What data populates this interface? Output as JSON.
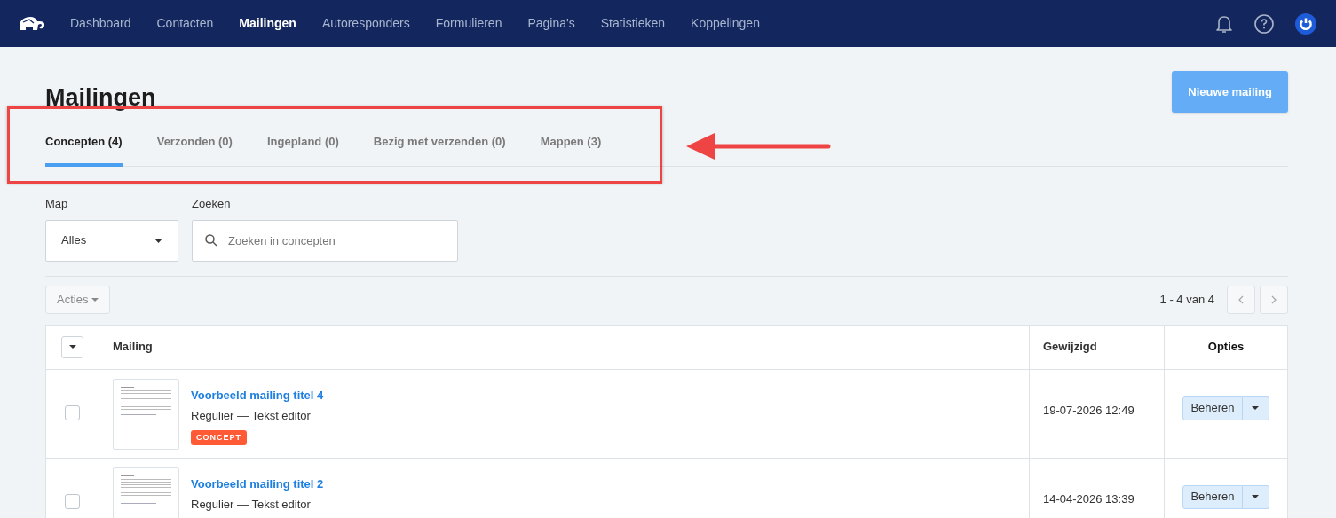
{
  "nav": {
    "items": [
      {
        "label": "Dashboard",
        "selected": false
      },
      {
        "label": "Contacten",
        "selected": false
      },
      {
        "label": "Mailingen",
        "selected": true
      },
      {
        "label": "Autoresponders",
        "selected": false
      },
      {
        "label": "Formulieren",
        "selected": false
      },
      {
        "label": "Pagina's",
        "selected": false
      },
      {
        "label": "Statistieken",
        "selected": false
      },
      {
        "label": "Koppelingen",
        "selected": false
      }
    ]
  },
  "page": {
    "title": "Mailingen",
    "new_button": "Nieuwe mailing"
  },
  "tabs": [
    {
      "label": "Concepten (4)",
      "selected": true
    },
    {
      "label": "Verzonden (0)",
      "selected": false
    },
    {
      "label": "Ingepland (0)",
      "selected": false
    },
    {
      "label": "Bezig met verzenden (0)",
      "selected": false
    },
    {
      "label": "Mappen (3)",
      "selected": false
    }
  ],
  "filters": {
    "folder_label": "Map",
    "folder_value": "Alles",
    "search_label": "Zoeken",
    "search_placeholder": "Zoeken in concepten"
  },
  "toolbar": {
    "actions": "Acties",
    "pagination": "1 - 4 van 4"
  },
  "table": {
    "columns": [
      "Mailing",
      "Gewijzigd",
      "Opties"
    ],
    "rows": [
      {
        "checked": false,
        "title": "Voorbeeld mailing titel 4",
        "subtitle": "Regulier — Tekst editor",
        "badge": "CONCEPT",
        "modified": "19-07-2026 12:49",
        "action": "Beheren"
      },
      {
        "checked": false,
        "title": "Voorbeeld mailing titel 2",
        "subtitle": "Regulier — Tekst editor",
        "modified": "14-04-2026 13:39",
        "action": "Beheren"
      }
    ]
  }
}
